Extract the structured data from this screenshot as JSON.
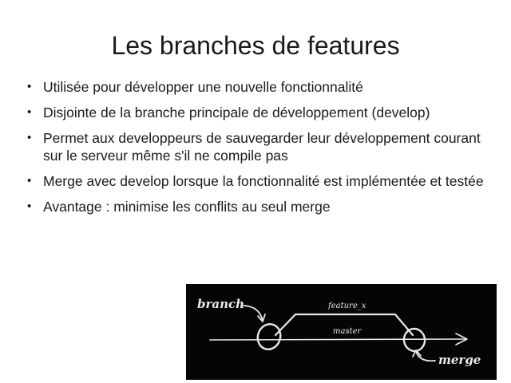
{
  "slide": {
    "title": "Les branches de features",
    "bullet_glyph": "•",
    "bullets": [
      "Utilisée pour développer une nouvelle fonctionnalité",
      "Disjointe de la branche principale de développement (develop)",
      "Permet aux developpeurs de sauvegarder leur développement courant sur le serveur même s'il ne compile pas",
      "Merge avec develop lorsque la fonctionnalité est implémentée et testée",
      "Avantage : minimise les conflits au seul merge"
    ]
  },
  "diagram": {
    "labels": {
      "branch": "branch",
      "feature": "feature_x",
      "master": "master",
      "merge": "merge"
    },
    "colors": {
      "background": "#050505",
      "chalk": "#e8e8e8"
    }
  }
}
